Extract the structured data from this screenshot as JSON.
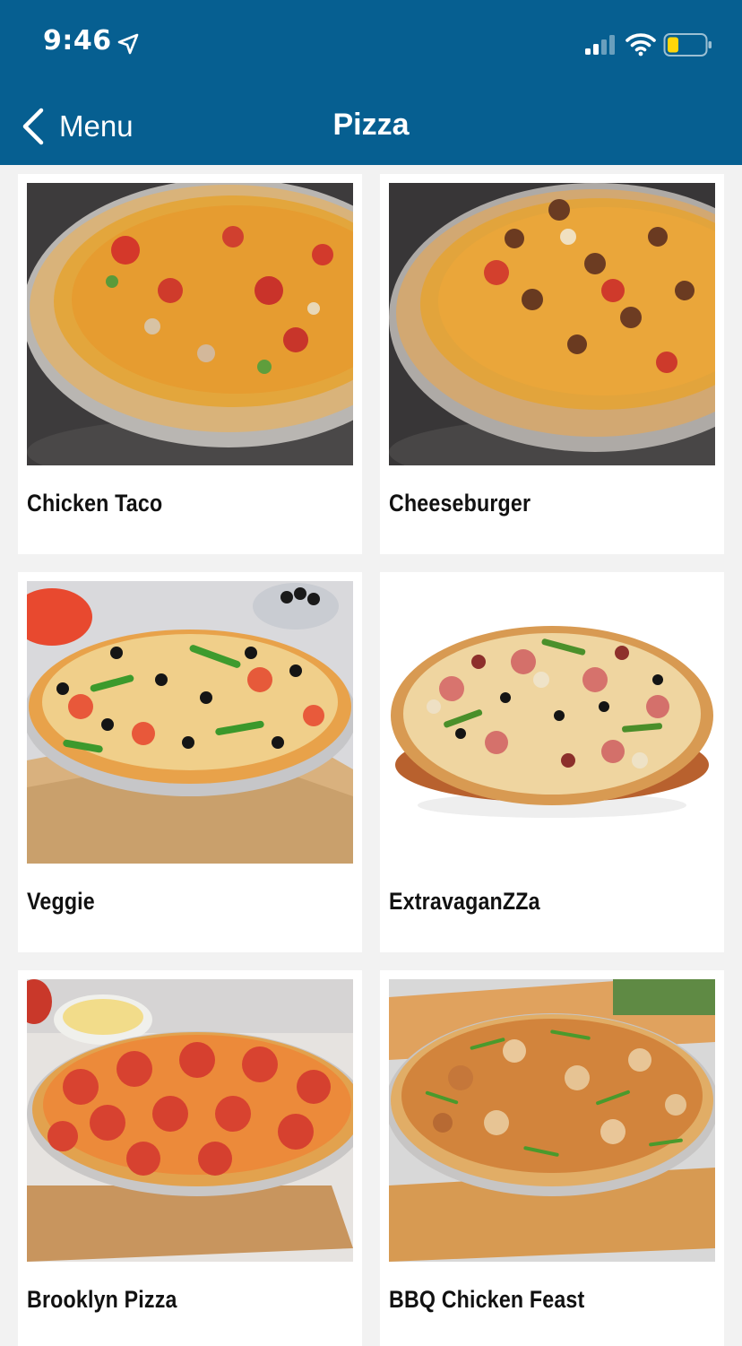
{
  "status_bar": {
    "time": "9:46",
    "icons": [
      "location-arrow-icon",
      "cellular-signal-icon",
      "wifi-icon",
      "battery-low-icon"
    ]
  },
  "nav": {
    "back_label": "Menu",
    "back_icon": "chevron-left-icon",
    "title": "Pizza"
  },
  "colors": {
    "header_bg": "#065f91",
    "page_bg": "#f2f2f2",
    "card_bg": "#ffffff",
    "battery_fill": "#ffd60a"
  },
  "products": [
    {
      "name": "Chicken Taco",
      "image": "pizza-photo"
    },
    {
      "name": "Cheeseburger",
      "image": "pizza-photo"
    },
    {
      "name": "Veggie",
      "image": "pizza-photo"
    },
    {
      "name": "ExtravaganZZa",
      "image": "pizza-photo"
    },
    {
      "name": "Brooklyn Pizza",
      "image": "pizza-photo"
    },
    {
      "name": "BBQ Chicken Feast",
      "image": "pizza-photo"
    }
  ]
}
